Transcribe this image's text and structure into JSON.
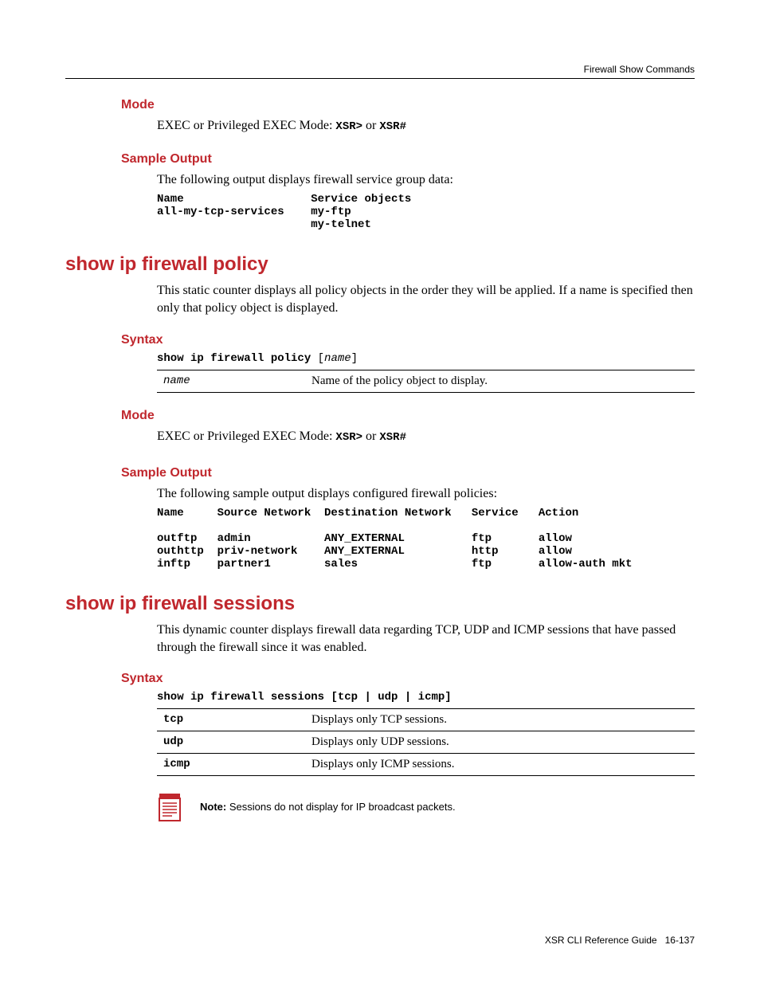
{
  "header": {
    "section_label": "Firewall Show Commands"
  },
  "section_mode1": {
    "title": "Mode",
    "text_prefix": "EXEC or Privileged EXEC Mode: ",
    "code1": "XSR>",
    "or": " or ",
    "code2": "XSR#"
  },
  "section_sample1": {
    "title": "Sample Output",
    "intro": "The following output displays firewall service group data:",
    "block": "Name                   Service objects\nall-my-tcp-services    my-ftp\n                       my-telnet"
  },
  "cmd_policy": {
    "title": "show ip firewall policy",
    "desc": "This static counter displays all policy objects in the order they will be applied. If a name is specified then only that policy object is displayed.",
    "syntax_title": "Syntax",
    "syntax_cmd": "show ip firewall policy",
    "syntax_bracket_open": " [",
    "syntax_param": "name",
    "syntax_bracket_close": "]",
    "param_table": {
      "key": "name",
      "desc": "Name of the policy object to display."
    },
    "mode": {
      "title": "Mode",
      "text_prefix": "EXEC or Privileged EXEC Mode: ",
      "code1": "XSR>",
      "or": " or ",
      "code2": "XSR#"
    },
    "sample": {
      "title": "Sample Output",
      "intro": "The following sample output displays configured firewall policies:"
    }
  },
  "chart_data": {
    "type": "table",
    "columns": [
      "Name",
      "Source Network",
      "Destination Network",
      "Service",
      "Action"
    ],
    "rows": [
      [
        "outftp",
        "admin",
        "ANY_EXTERNAL",
        "ftp",
        "allow"
      ],
      [
        "outhttp",
        "priv-network",
        "ANY_EXTERNAL",
        "http",
        "allow"
      ],
      [
        "inftp",
        "partner1",
        "sales",
        "ftp",
        "allow-auth mkt"
      ]
    ]
  },
  "cmd_sessions": {
    "title": "show ip firewall sessions",
    "desc": "This dynamic counter displays firewall data regarding TCP, UDP and ICMP sessions that have passed through the firewall since it was enabled.",
    "syntax_title": "Syntax",
    "syntax_cmd": "show ip firewall sessions",
    "syntax_opts": " [tcp | udp | icmp]",
    "param_table": [
      {
        "key": "tcp",
        "desc": "Displays only TCP sessions."
      },
      {
        "key": "udp",
        "desc": "Displays only UDP sessions."
      },
      {
        "key": "icmp",
        "desc": "Displays only ICMP sessions."
      }
    ],
    "note": {
      "label": "Note:",
      "text": " Sessions do not display for IP broadcast packets."
    }
  },
  "footer": {
    "guide": "XSR CLI Reference Guide",
    "page": "16-137"
  }
}
